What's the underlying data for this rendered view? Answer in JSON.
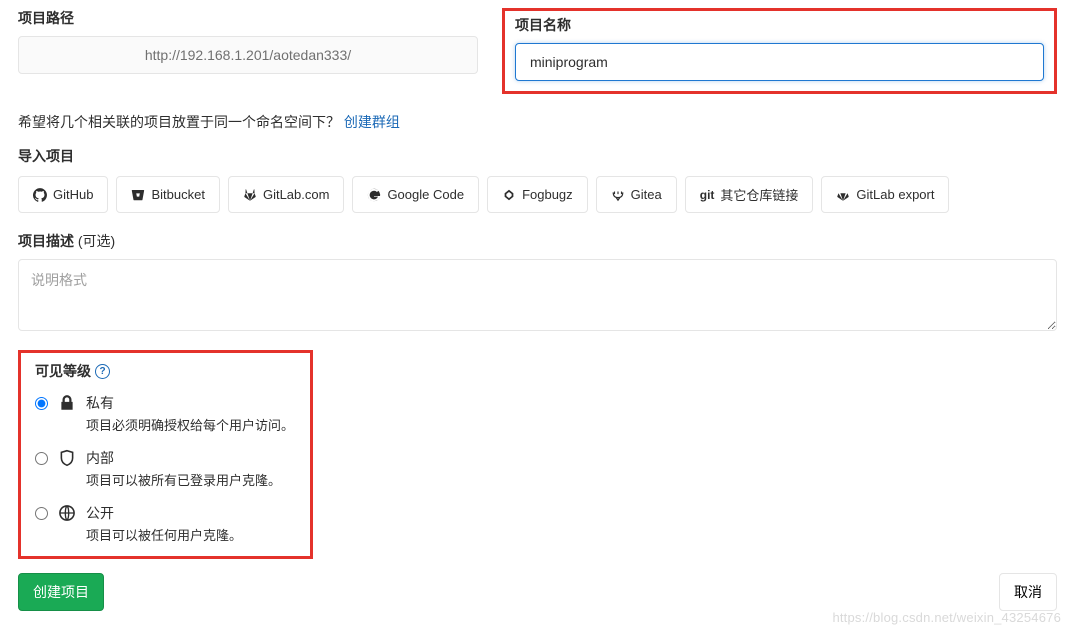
{
  "path": {
    "label": "项目路径",
    "value": "http://192.168.1.201/aotedan333/"
  },
  "name": {
    "label": "项目名称",
    "value": "miniprogram"
  },
  "group_hint": {
    "text": "希望将几个相关联的项目放置于同一个命名空间下？",
    "link": "创建群组"
  },
  "import": {
    "label": "导入项目",
    "providers": [
      {
        "id": "github",
        "label": "GitHub"
      },
      {
        "id": "bitbucket",
        "label": "Bitbucket"
      },
      {
        "id": "gitlabcom",
        "label": "GitLab.com"
      },
      {
        "id": "googlecode",
        "label": "Google Code"
      },
      {
        "id": "fogbugz",
        "label": "Fogbugz"
      },
      {
        "id": "gitea",
        "label": "Gitea"
      },
      {
        "id": "gitrepo",
        "label": "其它仓库链接"
      },
      {
        "id": "gitlabexport",
        "label": "GitLab export"
      }
    ]
  },
  "description": {
    "label": "项目描述",
    "optional": "(可选)",
    "placeholder": "说明格式"
  },
  "visibility": {
    "label": "可见等级",
    "options": [
      {
        "id": "private",
        "title": "私有",
        "desc": "项目必须明确授权给每个用户访问。",
        "checked": true
      },
      {
        "id": "internal",
        "title": "内部",
        "desc": "项目可以被所有已登录用户克隆。",
        "checked": false
      },
      {
        "id": "public",
        "title": "公开",
        "desc": "项目可以被任何用户克隆。",
        "checked": false
      }
    ]
  },
  "actions": {
    "create": "创建项目",
    "cancel": "取消"
  },
  "watermark": "https://blog.csdn.net/weixin_43254676"
}
